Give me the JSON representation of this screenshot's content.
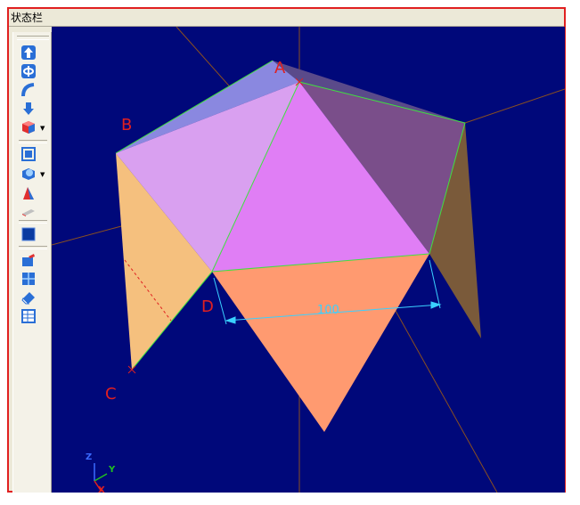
{
  "statusbar": {
    "text": "状态栏"
  },
  "toolbar": {
    "items": [
      {
        "icon": "extrude-up-icon"
      },
      {
        "icon": "revolve-icon"
      },
      {
        "icon": "sweep-icon"
      },
      {
        "icon": "move-down-icon"
      },
      {
        "icon": "solid-box-icon"
      },
      {
        "icon": "frame-box-icon"
      },
      {
        "icon": "shell-icon"
      },
      {
        "icon": "chamfer-icon"
      },
      {
        "icon": "plane-icon"
      },
      {
        "icon": "cube-icon"
      },
      {
        "icon": "box-edit-icon"
      },
      {
        "icon": "grid-cube-icon"
      },
      {
        "icon": "eraser-icon"
      },
      {
        "icon": "table-icon"
      }
    ]
  },
  "viewport": {
    "background": "#00087a",
    "vertex_labels": {
      "a": "A",
      "b": "B",
      "c": "C",
      "d": "D"
    },
    "dimension_text": "100",
    "axis_labels": {
      "x": "X",
      "y": "Y",
      "z": "Z"
    },
    "colors": {
      "face_top": "#d9a0f0",
      "face_front": "#e07ef5",
      "face_right": "#7a4e8a",
      "face_back_left": "#8a88e0",
      "face_left": "#f5c07e",
      "face_bottom": "#ff9a70",
      "face_far_right": "#7a5a3a",
      "label": "#e02020",
      "dimension": "#3ad0ff",
      "edge": "#40e040"
    }
  }
}
